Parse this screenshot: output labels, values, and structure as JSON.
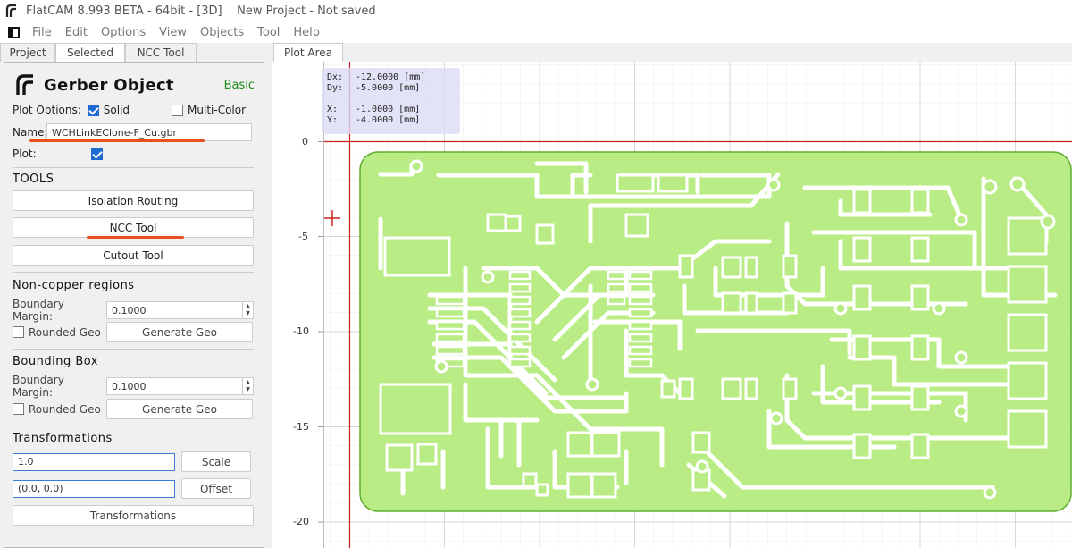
{
  "window": {
    "title": "FlatCAM 8.993 BETA - 64bit - [3D]    New Project - Not saved"
  },
  "menu": {
    "items": [
      "File",
      "Edit",
      "Options",
      "View",
      "Objects",
      "Tool",
      "Help"
    ]
  },
  "left_tabs": [
    "Project",
    "Selected",
    "NCC Tool"
  ],
  "plot_tab": "Plot Area",
  "panel": {
    "title": "Gerber Object",
    "mode": "Basic",
    "plot_options_label": "Plot Options:",
    "solid_label": "Solid",
    "multicolor_label": "Multi-Color",
    "name_label": "Name:",
    "name_value": "WCHLinkEClone-F_Cu.gbr",
    "plot_label": "Plot:",
    "tools_title": "TOOLS",
    "isolation_button": "Isolation Routing",
    "ncc_button": "NCC Tool",
    "cutout_button": "Cutout Tool",
    "noncopper_title": "Non-copper regions",
    "boundary_margin_label": "Boundary Margin:",
    "noncopper_margin": "0.1000",
    "rounded_geo_label": "Rounded Geo",
    "generate_geo_label": "Generate Geo",
    "bbox_title": "Bounding Box",
    "bbox_margin": "0.1000",
    "transform_title": "Transformations",
    "scale_value": "1.0",
    "scale_button": "Scale",
    "offset_value": "(0.0, 0.0)",
    "offset_button": "Offset",
    "transformations_button": "Transformations"
  },
  "readout": {
    "dx_label": "Dx:",
    "dx_value": "-12.0000 [mm]",
    "dy_label": "Dy:",
    "dy_value": "-5.0000 [mm]",
    "x_label": "X:",
    "x_value": "-1.0000 [mm]",
    "y_label": "Y:",
    "y_value": "-4.0000 [mm]"
  },
  "axis": {
    "y_ticks": [
      "0",
      "-5",
      "-10",
      "-15",
      "-20"
    ]
  },
  "colors": {
    "copper_fill": "#b9ec84",
    "copper_edge": "#5fae2e",
    "axis_red": "#cc2222",
    "accent_underline": "#e8501e",
    "mode_green": "#1a8a1a"
  }
}
